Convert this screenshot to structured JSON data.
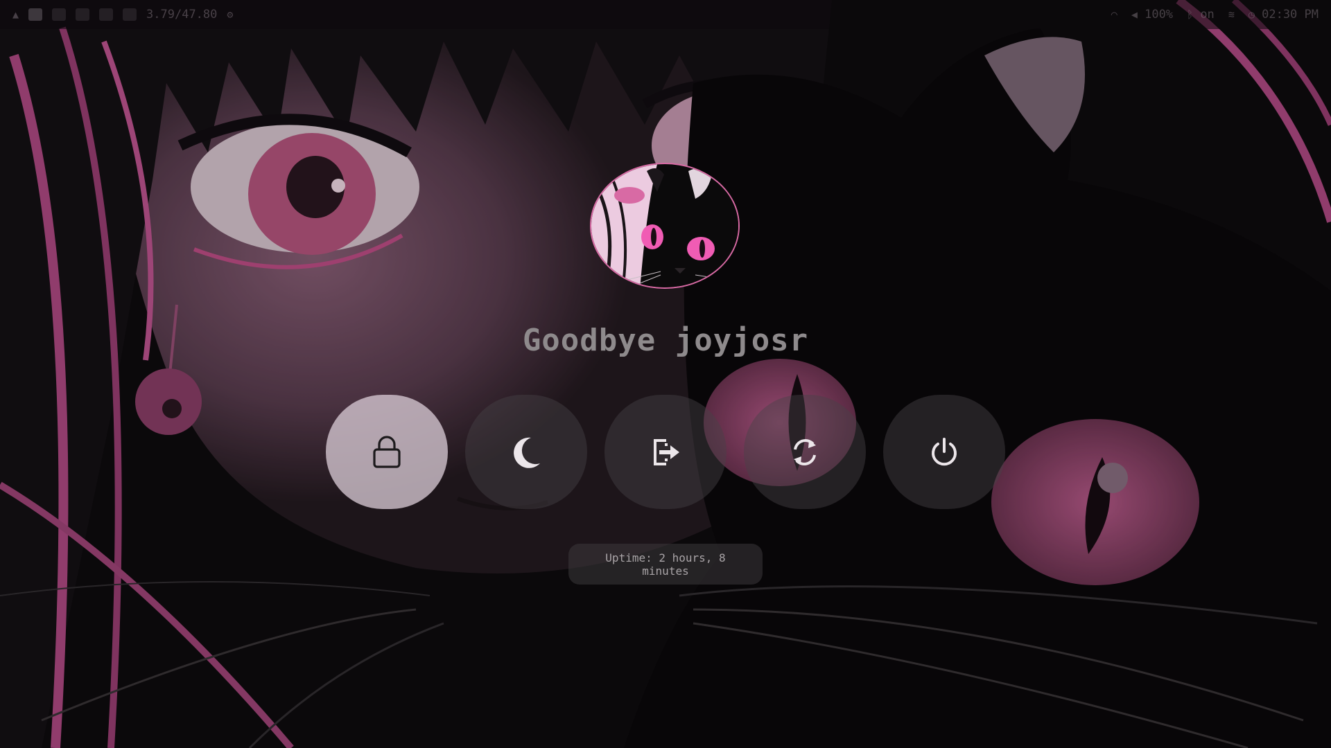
{
  "topbar": {
    "cpu_text": "3.79/47.80",
    "volume_text": "100%",
    "bluetooth_text": "on",
    "clock_text": "02:30 PM"
  },
  "menu": {
    "greeting": "Goodbye joyjosr",
    "uptime": "Uptime: 2 hours, 8 minutes",
    "selected": "lock",
    "actions": [
      {
        "id": "lock",
        "icon": "lock-icon"
      },
      {
        "id": "suspend",
        "icon": "moon-icon"
      },
      {
        "id": "logout",
        "icon": "logout-icon"
      },
      {
        "id": "reboot",
        "icon": "reboot-icon"
      },
      {
        "id": "shutdown",
        "icon": "power-icon"
      }
    ]
  },
  "colors": {
    "accent": "#d86aa4",
    "button_bg": "#46424a",
    "selected_button_bg": "#d6c8d2",
    "icon_dark": "#1c1a1c",
    "icon_light": "#ece6ea"
  }
}
